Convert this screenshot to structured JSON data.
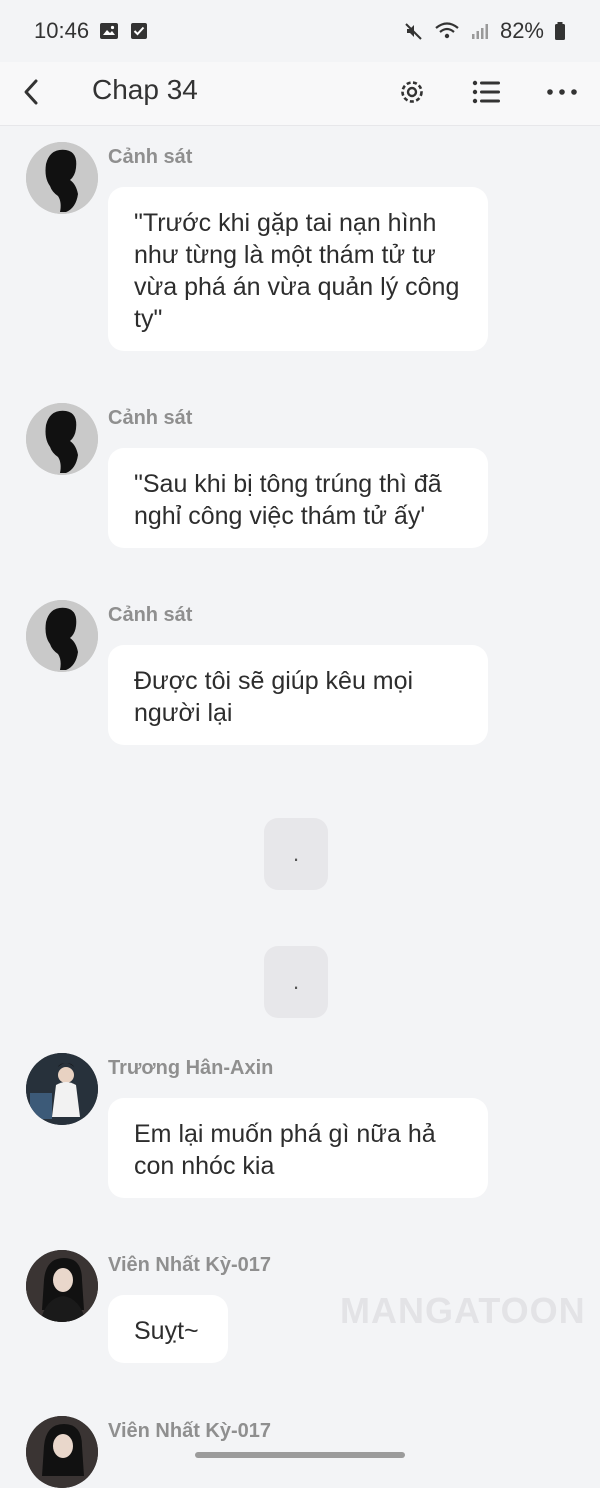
{
  "status_bar": {
    "time": "10:46",
    "battery": "82%"
  },
  "header": {
    "title": "Chap 34"
  },
  "messages": [
    {
      "sender": "Cảnh sát",
      "text": "\"Trước khi gặp tai nạn hình như từng là một thám tử tư vừa phá án vừa quản lý công ty\""
    },
    {
      "sender": "Cảnh sát",
      "text": "\"Sau khi bị tông trúng thì đã nghỉ công việc thám tử ấy'"
    },
    {
      "sender": "Cảnh sát",
      "text": "Được tôi sẽ giúp kêu mọi người lại"
    },
    {
      "narration": "."
    },
    {
      "narration": "."
    },
    {
      "sender": "Trương Hân-Axin",
      "text": "Em lại muốn phá gì nữa hả con nhóc kia"
    },
    {
      "sender": "Viên Nhất Kỳ-017",
      "text": "Suỵt~"
    },
    {
      "sender": "Viên Nhất Kỳ-017"
    }
  ],
  "watermark": "MANGATOON"
}
